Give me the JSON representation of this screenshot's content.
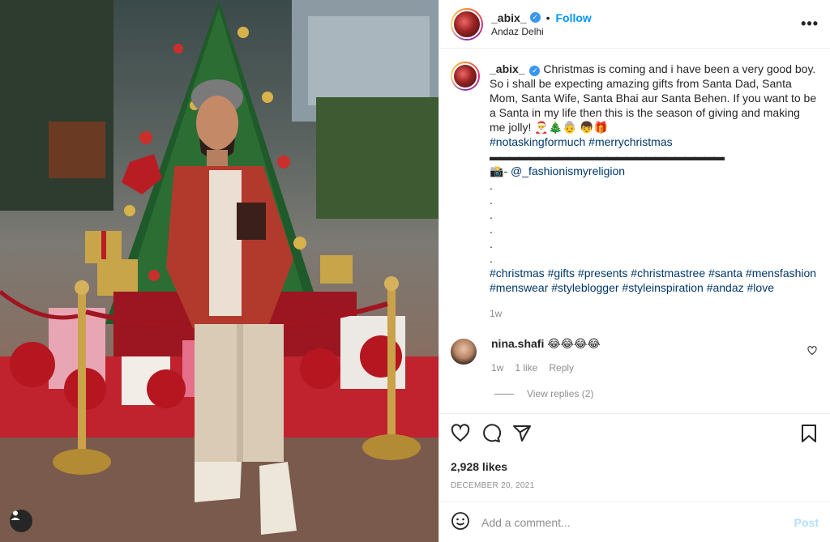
{
  "post": {
    "author": "_abix_",
    "follow_label": "Follow",
    "location": "Andaz Delhi",
    "more_label": "•••"
  },
  "caption": {
    "username": "_abix_",
    "text": "Christmas is coming and i have been a very good boy. So i shall be expecting amazing gifts from Santa Dad, Santa Mom, Santa Wife, Santa Bhai aur Santa Behen. If you want to be a Santa in my life then this is the season of giving and making me jolly! 🎅🎄👵 👦🎁",
    "hashtags_1": "#notaskingformuch #merrychristmas",
    "separator": "▬▬▬▬▬▬▬▬▬▬▬▬▬▬▬▬▬▬▬▬▬▬▬▬",
    "credit_icon": "📸",
    "credit": "- @_fashionismyreligion",
    "dots": [
      ".",
      ".",
      ".",
      ".",
      ".",
      "."
    ],
    "hashtags_2": "#christmas #gifts #presents #christmastree #santa #mensfashion #menswear #styleblogger #styleinspiration #andaz #love",
    "time": "1w"
  },
  "comment": {
    "username": "nina.shafi",
    "text": "😂😂😂😂",
    "time": "1w",
    "likes": "1 like",
    "reply": "Reply",
    "view_replies": "View replies (2)"
  },
  "actions": {
    "likes": "2,928 likes",
    "date": "DECEMBER 20, 2021"
  },
  "composer": {
    "placeholder": "Add a comment...",
    "post_label": "Post"
  },
  "colors": {
    "accent": "#0095f6",
    "link": "#00376b",
    "muted": "#8e8e8e",
    "post_disabled": "#b2dffc"
  },
  "icons": [
    "verified-badge-icon",
    "more-options-icon",
    "emoji-icon",
    "heart-icon",
    "comment-icon",
    "share-icon",
    "bookmark-icon",
    "user-tag-icon"
  ]
}
